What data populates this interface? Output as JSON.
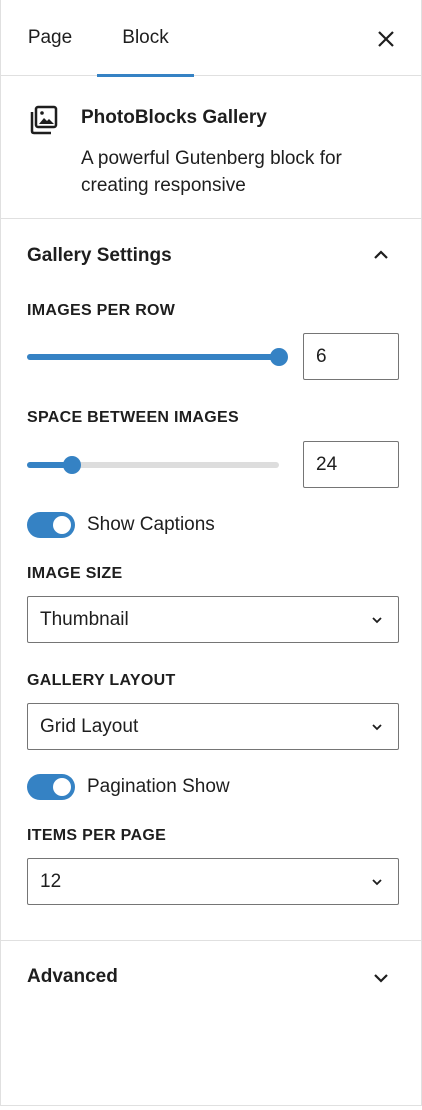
{
  "tabs": {
    "page_label": "Page",
    "block_label": "Block",
    "active": "Block"
  },
  "block": {
    "title": "PhotoBlocks Gallery",
    "description": "A powerful Gutenberg block for creating responsive"
  },
  "gallery_settings": {
    "title": "Gallery Settings",
    "expanded": true,
    "images_per_row": {
      "label": "IMAGES PER ROW",
      "value": "6",
      "slider_fraction": 1.0
    },
    "space_between_images": {
      "label": "SPACE BETWEEN IMAGES",
      "value": "24",
      "slider_fraction": 0.18
    },
    "show_captions": {
      "label": "Show Captions",
      "enabled": true
    },
    "image_size": {
      "label": "IMAGE SIZE",
      "selected": "Thumbnail"
    },
    "gallery_layout": {
      "label": "GALLERY LAYOUT",
      "selected": "Grid Layout"
    },
    "pagination": {
      "label": "Pagination Show",
      "enabled": true
    },
    "items_per_page": {
      "label": "ITEMS PER PAGE",
      "selected": "12"
    }
  },
  "advanced": {
    "title": "Advanced",
    "expanded": false
  },
  "colors": {
    "accent": "#3582c4",
    "border": "#e0e0e0",
    "text": "#1e1e1e",
    "track": "#dddddd"
  }
}
